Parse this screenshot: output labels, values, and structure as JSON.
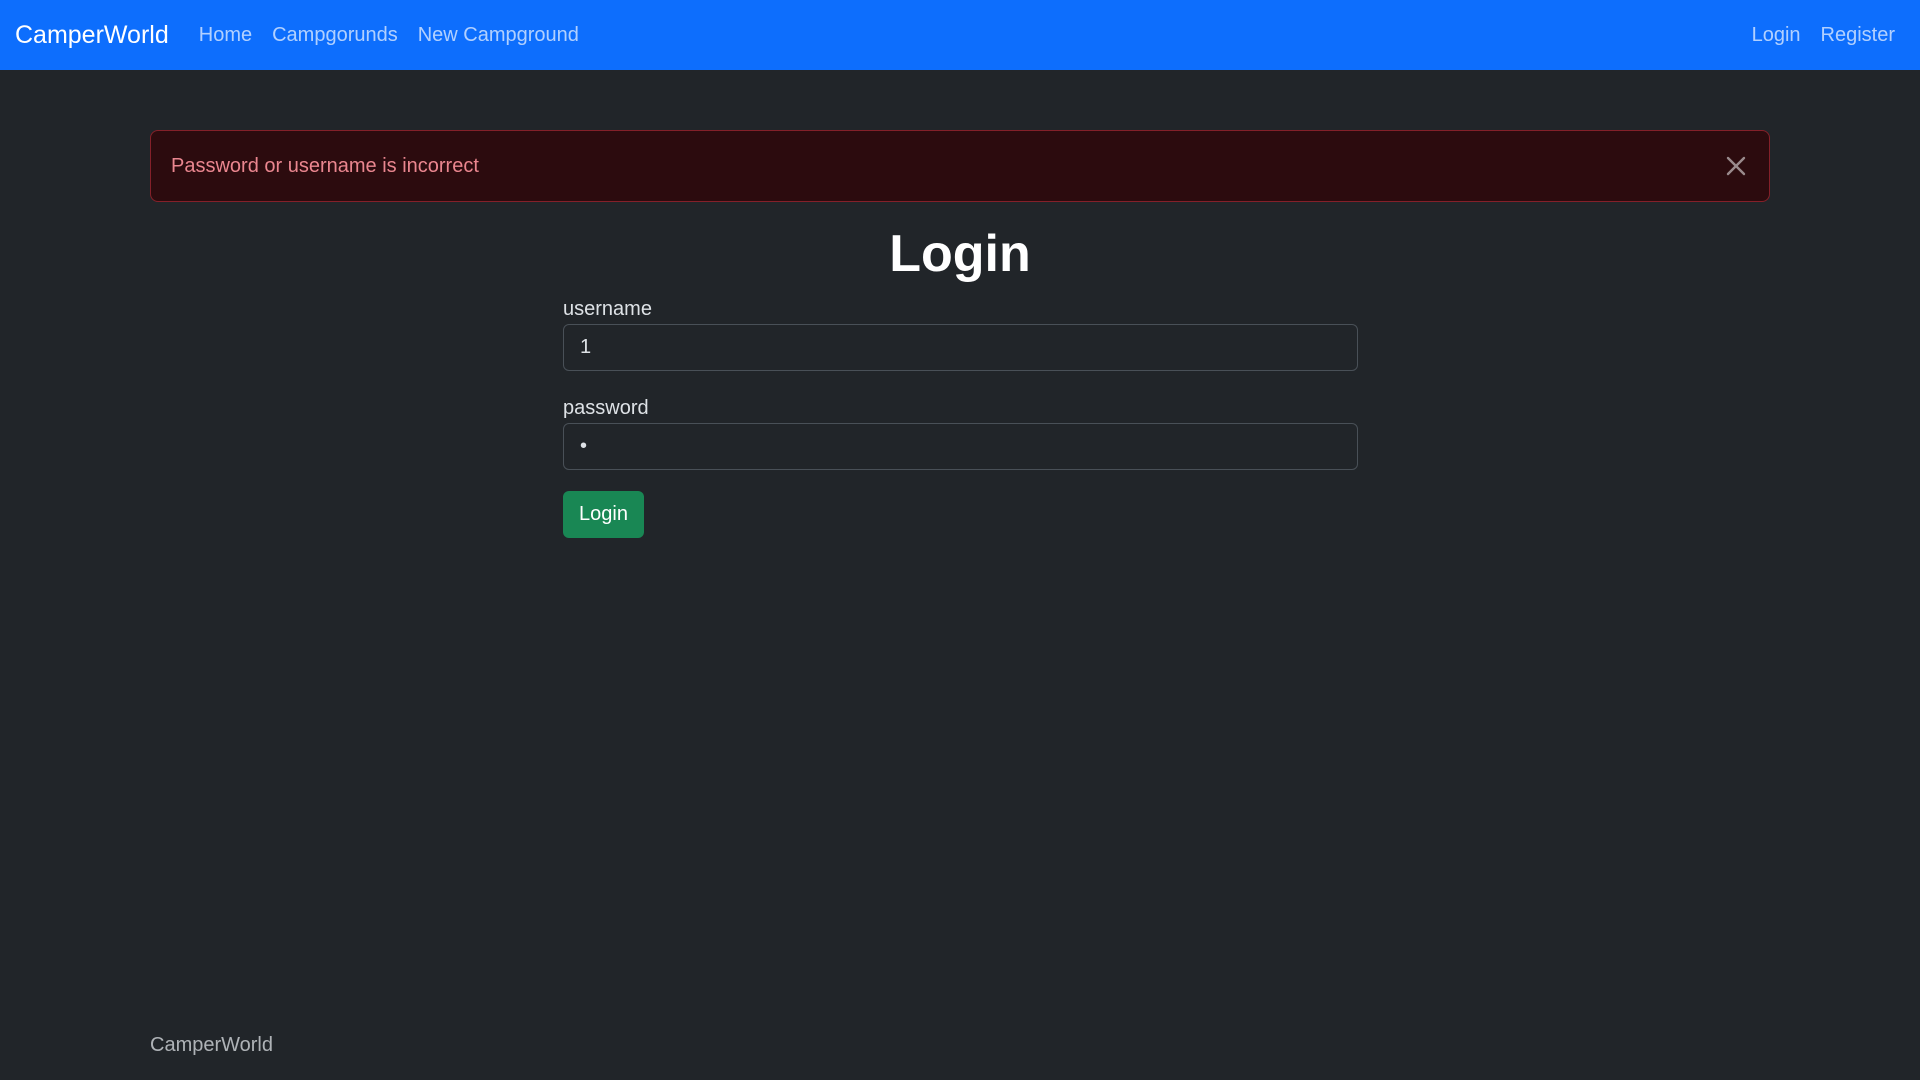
{
  "navbar": {
    "brand": "CamperWorld",
    "left_links": [
      "Home",
      "Campgorunds",
      "New Campground"
    ],
    "right_links": [
      "Login",
      "Register"
    ]
  },
  "alert": {
    "message": "Password or username is incorrect",
    "close_icon": "close-icon"
  },
  "page": {
    "title": "Login"
  },
  "form": {
    "username_label": "username",
    "username_value": "1",
    "password_label": "password",
    "password_value": "•",
    "submit_label": "Login"
  },
  "footer": {
    "text": "CamperWorld"
  },
  "colors": {
    "navbar_bg": "#0d6efd",
    "body_bg": "#212529",
    "alert_bg": "#2c0b0e",
    "alert_border": "#842029",
    "alert_text": "#ea868f",
    "button_bg": "#198754"
  }
}
